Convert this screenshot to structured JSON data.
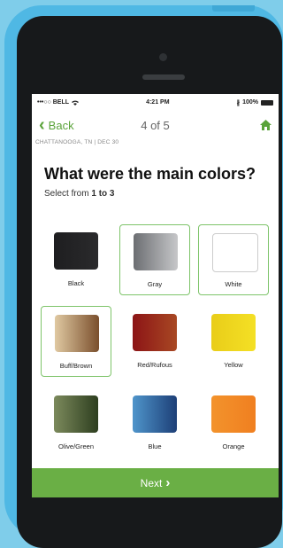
{
  "status_bar": {
    "carrier": "•••○○ BELL",
    "wifi_icon": "wifi-icon",
    "time": "4:21 PM",
    "bluetooth_icon": "bluetooth-icon",
    "battery_text": "100%"
  },
  "nav": {
    "back_label": "Back",
    "step": "4 of 5",
    "home_icon": "home-icon"
  },
  "location": "CHATTANOOGA, TN  |  DEC 30",
  "question": {
    "title": "What were the main colors?",
    "subtitle_prefix": "Select from ",
    "subtitle_range": "1 to 3"
  },
  "colors": [
    {
      "label": "Black",
      "selected": false,
      "gradient": [
        "#1e1e20",
        "#2a2a2c"
      ]
    },
    {
      "label": "Gray",
      "selected": true,
      "gradient": [
        "#6c6e72",
        "#c6c7c9"
      ]
    },
    {
      "label": "White",
      "selected": true,
      "gradient": [
        "#ffffff",
        "#ffffff"
      ]
    },
    {
      "label": "Buff/Brown",
      "selected": true,
      "gradient": [
        "#e0c9a2",
        "#7a4f2c"
      ]
    },
    {
      "label": "Red/Rufous",
      "selected": false,
      "gradient": [
        "#8c1416",
        "#a84823"
      ]
    },
    {
      "label": "Yellow",
      "selected": false,
      "gradient": [
        "#e9cd19",
        "#f4e025"
      ]
    },
    {
      "label": "Olive/Green",
      "selected": false,
      "gradient": [
        "#7c8a5c",
        "#2d3e1f"
      ]
    },
    {
      "label": "Blue",
      "selected": false,
      "gradient": [
        "#4f95cb",
        "#1d3f77"
      ]
    },
    {
      "label": "Orange",
      "selected": false,
      "gradient": [
        "#f3932c",
        "#f07f20"
      ]
    }
  ],
  "next_label": "Next",
  "accent_color": "#6aaf45"
}
